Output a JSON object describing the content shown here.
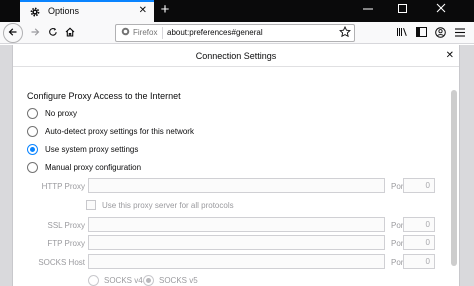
{
  "tab": {
    "title": "Options",
    "icon": "gear-icon"
  },
  "titlebar": {
    "new_tab": "+",
    "minimize": "—",
    "maximize": "☐",
    "close": "✕"
  },
  "navbar": {
    "identity": "Firefox",
    "url": "about:preferences#general"
  },
  "dialog": {
    "title": "Connection Settings",
    "close": "✕",
    "section_title": "Configure Proxy Access to the Internet",
    "options": [
      {
        "label": "No proxy",
        "checked": false
      },
      {
        "label": "Auto-detect proxy settings for this network",
        "checked": false
      },
      {
        "label": "Use system proxy settings",
        "checked": true
      },
      {
        "label": "Manual proxy configuration",
        "checked": false
      }
    ],
    "http_label": "HTTP Proxy",
    "share_label": "Use this proxy server for all protocols",
    "ssl_label": "SSL Proxy",
    "ftp_label": "FTP Proxy",
    "socks_label": "SOCKS Host",
    "port_label": "Port",
    "port_value": "0",
    "socks_v4": "SOCKS v4",
    "socks_v5": "SOCKS v5"
  }
}
